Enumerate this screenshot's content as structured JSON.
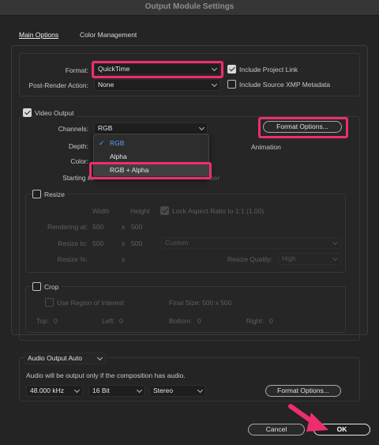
{
  "window": {
    "title": "Output Module Settings"
  },
  "tabs": [
    {
      "label": "Main Options"
    },
    {
      "label": "Color Management"
    }
  ],
  "top": {
    "format_label": "Format:",
    "format_value": "QuickTime",
    "post_render_label": "Post-Render Action:",
    "post_render_value": "None",
    "include_project_link": "Include Project Link",
    "include_xmp": "Include Source XMP Metadata"
  },
  "video": {
    "section_label": "Video Output",
    "channels_label": "Channels:",
    "channels_value": "RGB",
    "depth_label": "Depth:",
    "color_label": "Color:",
    "starting_label": "Starting #:",
    "starting_suffix": "ber",
    "format_options_button": "Format Options...",
    "codec_text": "Animation",
    "channel_menu": [
      "RGB",
      "Alpha",
      "RGB + Alpha"
    ]
  },
  "resize": {
    "label": "Resize",
    "col_width": "Width",
    "col_height": "Height",
    "lock_aspect": "Lock Aspect Ratio to 1:1 (1.00)",
    "rendering_at_label": "Rendering at:",
    "rendering_w": "500",
    "rendering_x": "x",
    "rendering_h": "500",
    "resize_to_label": "Resize to:",
    "resize_w": "500",
    "resize_x": "x",
    "resize_h": "500",
    "preset_value": "Custom",
    "resize_pct_label": "Resize %:",
    "resize_pct_x": "x",
    "quality_label": "Resize Quality:",
    "quality_value": "High"
  },
  "crop": {
    "label": "Crop",
    "use_roi": "Use Region of Interest",
    "final_size": "Final Size: 500 x 500",
    "top": "Top:",
    "top_val": "0",
    "left": "Left:",
    "left_val": "0",
    "bottom": "Bottom:",
    "bottom_val": "0",
    "right": "Right:",
    "right_val": "0"
  },
  "audio": {
    "output_value": "Audio Output Auto",
    "info_text": "Audio will be output only if the composition has audio.",
    "sample_rate": "48.000 kHz",
    "bit_depth": "16 Bit",
    "channels": "Stereo",
    "format_options_button": "Format Options..."
  },
  "footer": {
    "cancel": "Cancel",
    "ok": "OK"
  },
  "colors": {
    "highlight": "#ee2d6f",
    "selected_menu_text": "#4aa3ff"
  }
}
